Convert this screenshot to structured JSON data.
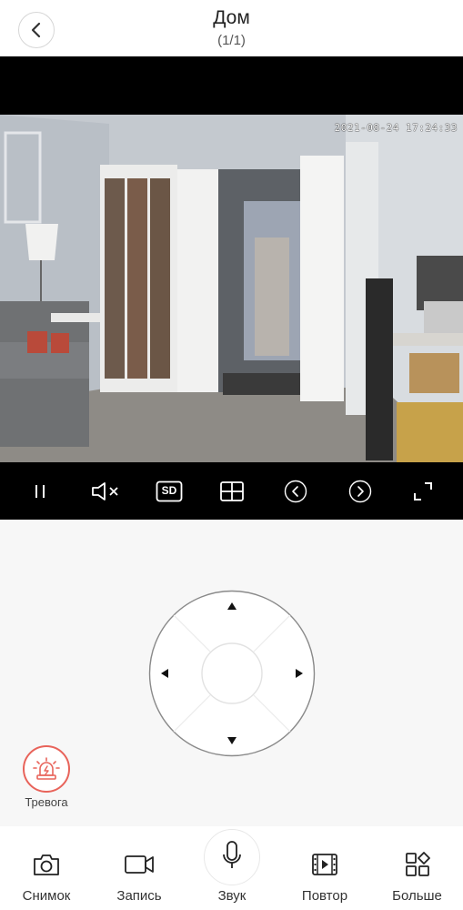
{
  "header": {
    "title": "Дом",
    "subtitle": "(1/1)",
    "back_icon": "chevron-left-icon"
  },
  "video": {
    "timestamp": "2021-08-24 17:24:33"
  },
  "controls": {
    "items": [
      {
        "name": "pause",
        "icon": "pause-icon"
      },
      {
        "name": "mute",
        "icon": "speaker-muted-icon"
      },
      {
        "name": "quality",
        "icon": "sd-quality-icon",
        "label": "SD"
      },
      {
        "name": "multiview",
        "icon": "grid-view-icon"
      },
      {
        "name": "prev",
        "icon": "arrow-left-circle-icon"
      },
      {
        "name": "next",
        "icon": "arrow-right-circle-icon"
      },
      {
        "name": "fullscreen",
        "icon": "fullscreen-icon"
      }
    ]
  },
  "ptz": {
    "joystick_icon": "direction-pad-icon"
  },
  "alarm": {
    "label": "Тревога",
    "icon": "siren-icon",
    "color": "#e8635a"
  },
  "tabs": [
    {
      "label": "Снимок",
      "icon": "camera-icon"
    },
    {
      "label": "Запись",
      "icon": "video-camera-icon"
    },
    {
      "label": "Звук",
      "icon": "microphone-icon"
    },
    {
      "label": "Повтор",
      "icon": "film-playback-icon"
    },
    {
      "label": "Больше",
      "icon": "more-grid-icon"
    }
  ]
}
